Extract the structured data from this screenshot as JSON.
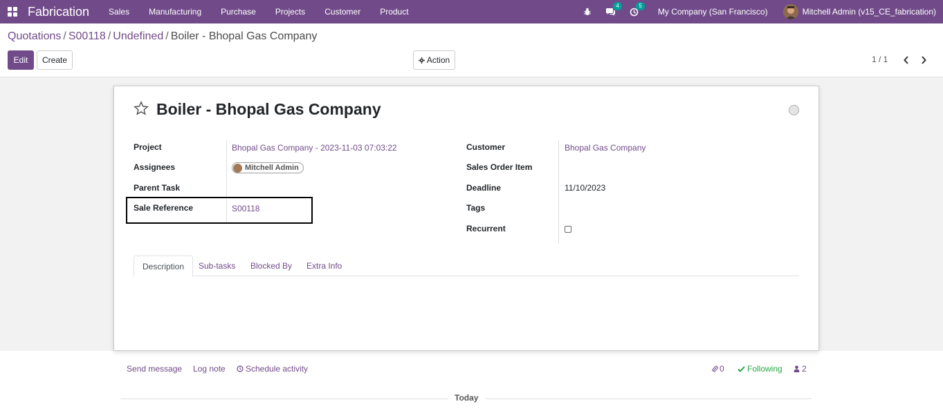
{
  "navbar": {
    "app_name": "Fabrication",
    "menu": [
      "Sales",
      "Manufacturing",
      "Purchase",
      "Projects",
      "Customer",
      "Product"
    ],
    "messages_count": "4",
    "activities_count": "5",
    "company": "My Company (San Francisco)",
    "user": "Mitchell Admin (v15_CE_fabrication)",
    "icons": [
      "apps-icon",
      "bug-icon",
      "chat-icon",
      "clock-icon"
    ]
  },
  "breadcrumb": {
    "items": [
      "Quotations",
      "S00118",
      "Undefined"
    ],
    "current": "Boiler - Bhopal Gas Company"
  },
  "toolbar": {
    "edit_label": "Edit",
    "create_label": "Create",
    "action_label": "Action",
    "pager": "1 / 1"
  },
  "record": {
    "title": "Boiler - Bhopal Gas Company",
    "left_fields": {
      "project_label": "Project",
      "project_value": "Bhopal Gas Company - 2023-11-03 07:03:22",
      "assignees_label": "Assignees",
      "assignees_value": "Mitchell Admin",
      "parent_task_label": "Parent Task",
      "sale_reference_label": "Sale Reference",
      "sale_reference_value": "S00118"
    },
    "right_fields": {
      "customer_label": "Customer",
      "customer_value": "Bhopal Gas Company",
      "sales_order_item_label": "Sales Order Item",
      "deadline_label": "Deadline",
      "deadline_value": "11/10/2023",
      "tags_label": "Tags",
      "recurrent_label": "Recurrent"
    },
    "tabs": [
      "Description",
      "Sub-tasks",
      "Blocked By",
      "Extra Info"
    ]
  },
  "chatter": {
    "send_message": "Send message",
    "log_note": "Log note",
    "schedule_activity": "Schedule activity",
    "attachments_count": "0",
    "following": "Following",
    "followers_count": "2",
    "today": "Today"
  },
  "colors": {
    "brand": "#714b89",
    "following": "#28a745"
  }
}
